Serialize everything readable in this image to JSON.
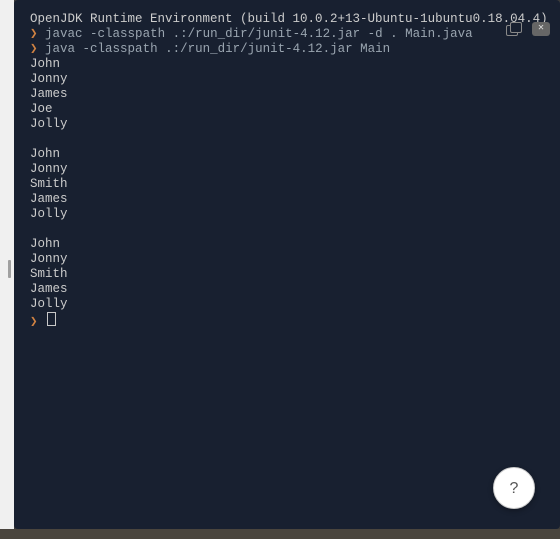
{
  "header_line": "OpenJDK Runtime Environment (build 10.0.2+13-Ubuntu-1ubuntu0.18.04.4)",
  "commands": [
    "javac -classpath .:/run_dir/junit-4.12.jar -d . Main.java",
    "java -classpath .:/run_dir/junit-4.12.jar Main"
  ],
  "prompt_symbol": "❯",
  "output_blocks": [
    [
      "John",
      "Jonny",
      "James",
      "Joe",
      "Jolly"
    ],
    [
      "John",
      "Jonny",
      "Smith",
      "James",
      "Jolly"
    ],
    [
      "John",
      "Jonny",
      "Smith",
      "James",
      "Jolly"
    ]
  ],
  "help_label": "?"
}
